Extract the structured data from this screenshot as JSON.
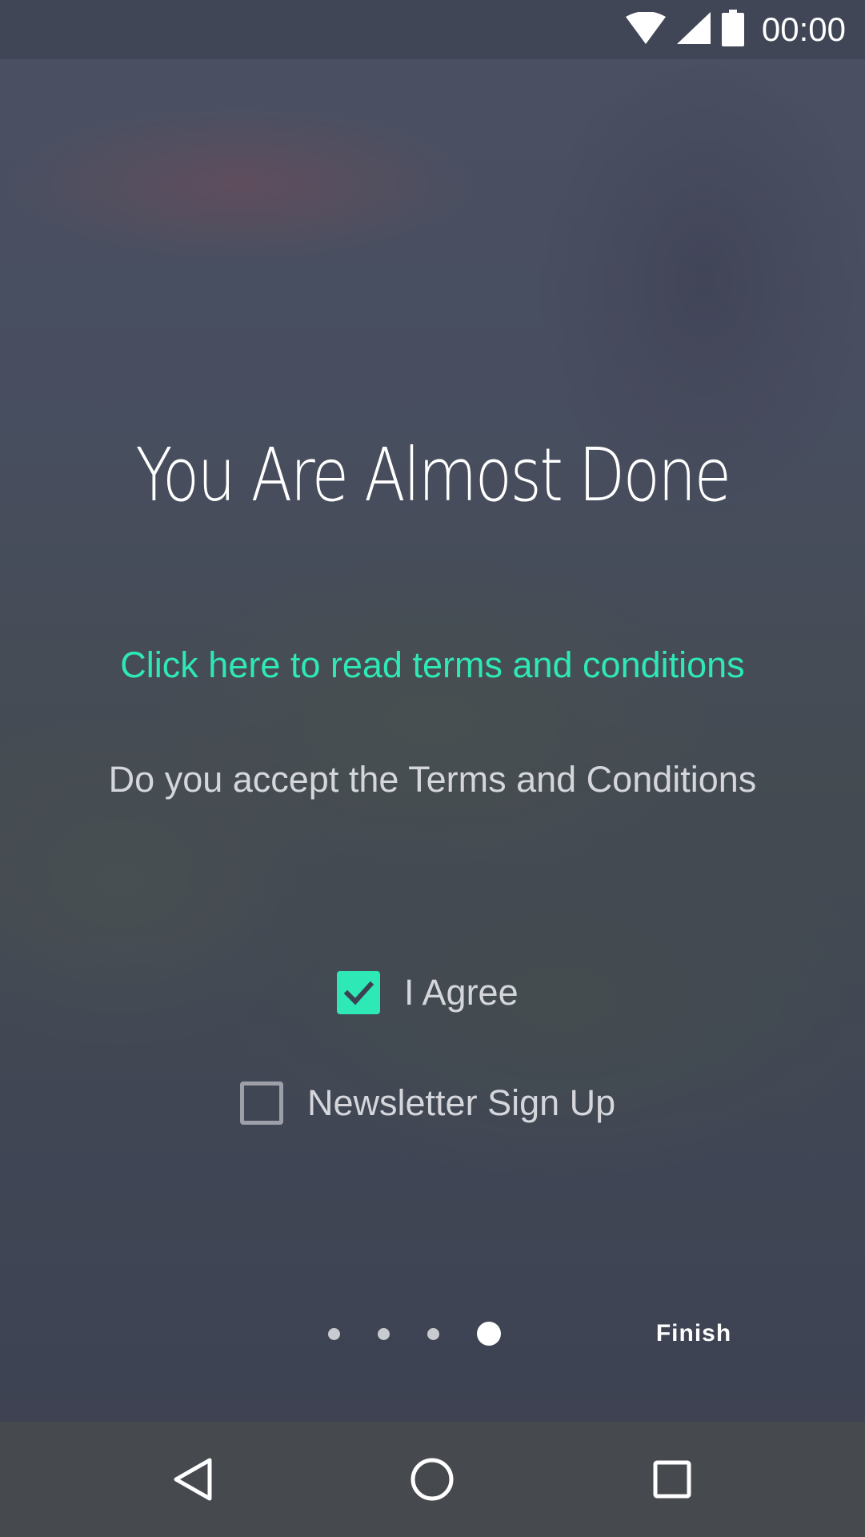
{
  "status_bar": {
    "time": "00:00",
    "icons": [
      "wifi-icon",
      "cell-signal-icon",
      "battery-icon"
    ]
  },
  "onboarding": {
    "title": "You Are Almost Done",
    "terms_link": "Click here to read terms and conditions",
    "question": "Do you accept the Terms and Conditions",
    "checkboxes": [
      {
        "label": "I Agree",
        "checked": true
      },
      {
        "label": "Newsletter Sign Up",
        "checked": false
      }
    ],
    "pager": {
      "total": 4,
      "current": 4
    },
    "finish_label": "Finish"
  },
  "navigation_bar": {
    "buttons": [
      "back-icon",
      "home-icon",
      "recent-apps-icon"
    ]
  },
  "colors": {
    "accent": "#2ee8b6",
    "overlay": "#3c4152",
    "nav_bar": "#46494e"
  }
}
